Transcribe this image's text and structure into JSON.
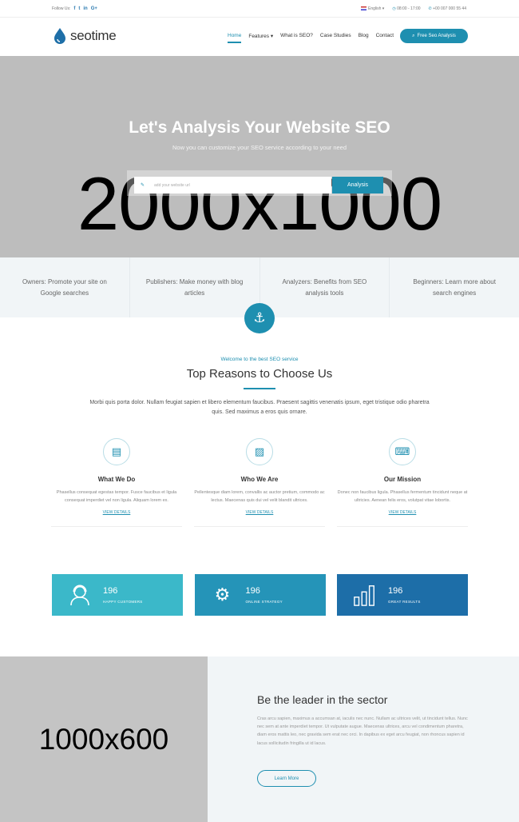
{
  "topbar": {
    "follow_label": "Follow Us:",
    "social": [
      "f",
      "t",
      "in",
      "G+"
    ],
    "language": "English",
    "hours": "08:00 - 17:00",
    "phone": "+00 007 000 55 44"
  },
  "header": {
    "logo_text": "seotime",
    "nav": [
      "Home",
      "Features",
      "What is SEO?",
      "Case Studies",
      "Blog",
      "Contact"
    ],
    "cta": "Free Seo Analysis"
  },
  "hero": {
    "placeholder_text": "2000x1000",
    "title": "Let's Analysis Your Website SEO",
    "subtitle": "Now you can customize your SEO service according to your need",
    "search_placeholder": "add your website url",
    "search_button": "Analysis"
  },
  "features": [
    "Owners: Promote your site on Google searches",
    "Publishers: Make money with blog articles",
    "Analyzers: Benefits from SEO analysis tools",
    "Beginners: Learn more about search engines"
  ],
  "reasons": {
    "kicker": "Welcome to the best SEO service",
    "title": "Top Reasons to Choose Us",
    "body": "Morbi quis porta dolor. Nullam feugiat sapien et libero elementum faucibus. Praesent sagittis venenatis ipsum, eget tristique odio pharetra quis. Sed maximus a eros quis ornare.",
    "columns": [
      {
        "heading": "What We Do",
        "text": "Phasellus consequat egestas tempor. Fusce faucibus et ligula consequat imperdiet vel non ligula. Aliquam lorem ex.",
        "link": "VIEW DETAILS"
      },
      {
        "heading": "Who We Are",
        "text": "Pellentesque diam lorem, convallis ac auctor pretium, commodo ac lectus. Maecenas quis dui vel velit blandit ultrices.",
        "link": "VIEW DETAILS"
      },
      {
        "heading": "Our Mission",
        "text": "Donec non faucibus ligula. Phasellus fermentum tincidunt neque at ultricies. Aenean felis eros, volutpat vitae lobortis.",
        "link": "VIEW DETAILS"
      }
    ]
  },
  "stats": [
    {
      "number": "196",
      "label": "HAPPY CUSTOMERS",
      "color": "#3bb8c9",
      "icon": "customer-icon"
    },
    {
      "number": "196",
      "label": "ONLINE STRATEGY",
      "color": "#2594b8",
      "icon": "gears-flask-icon"
    },
    {
      "number": "196",
      "label": "GREAT RESULTS",
      "color": "#1d6ea8",
      "icon": "bar-chart-icon"
    }
  ],
  "leader": {
    "placeholder_text": "1000x600",
    "heading": "Be the leader in the sector",
    "body": "Cras arcu sapien, maximus a accumsan at, iaculis nec nunc. Nullam ac ultrices velit, ut tincidunt tellus. Nunc nec sem at ante imperdiet tempor. Ut vulputate augue. Maecenas ultrices, arcu vel condimentum pharetra, diam eros mattis leo, nec gravida sem erat nec orci. In dapibus ex eget arcu feugiat, non rhoncus sapien id lacus sollicitudin fringilla ut id lacus.",
    "button": "Learn More"
  },
  "colors": {
    "accent": "#1e8fb0",
    "hero_bg": "#bdbdbd",
    "light_bg": "#f1f5f7"
  }
}
